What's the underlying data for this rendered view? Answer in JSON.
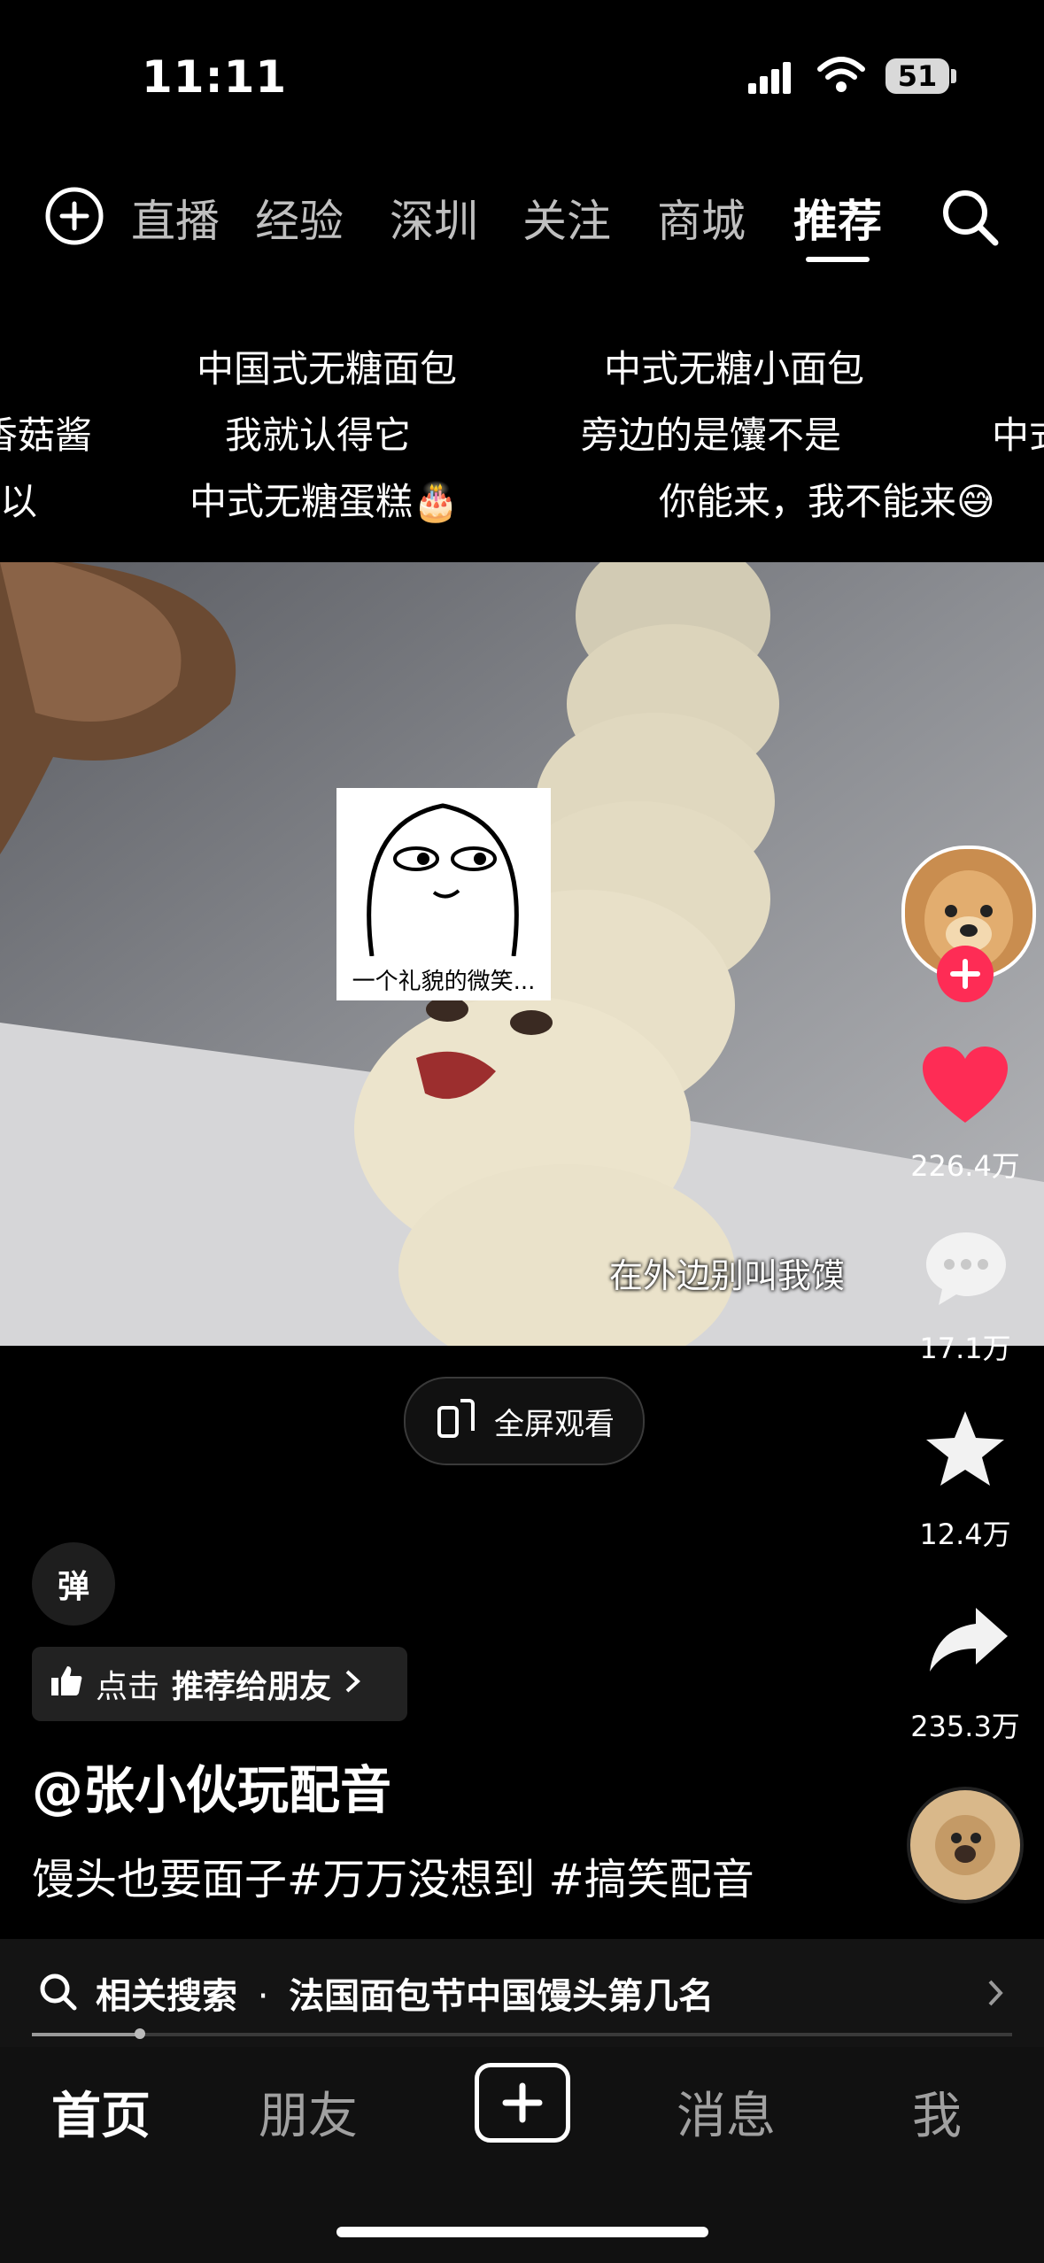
{
  "status": {
    "time": "11:11",
    "battery": "51"
  },
  "nav": {
    "tabs": [
      "直播",
      "经验",
      "深圳",
      "关注",
      "商城",
      "推荐"
    ],
    "active": "推荐"
  },
  "danmaku": {
    "row1": [
      "中国式无糖面包",
      "中式无糖小面包"
    ],
    "row2": [
      "香菇酱",
      "我就认得它",
      "旁边的是馕不是",
      "中式"
    ],
    "row3": [
      "以",
      "中式无糖蛋糕🎂",
      "你能来，我不能来😅"
    ]
  },
  "video": {
    "sticker_caption": "一个礼貌的微笑...",
    "subtitle": "在外边别叫我馍"
  },
  "fullscreen_label": "全屏观看",
  "rail": {
    "likes": "226.4万",
    "comments": "17.1万",
    "favorites": "12.4万",
    "shares": "235.3万"
  },
  "danmu_toggle": "弹",
  "recommend": {
    "prefix": "点击",
    "text": "推荐给朋友"
  },
  "author": "@张小伙玩配音",
  "caption": "馒头也要面子#万万没想到 #搞笑配音",
  "related": {
    "label": "相关搜索",
    "sep": "·",
    "query": "法国面包节中国馒头第几名"
  },
  "progress": 0.11,
  "bottom_nav": {
    "home": "首页",
    "friends": "朋友",
    "messages": "消息",
    "me": "我"
  },
  "colors": {
    "like": "#fe2c55",
    "follow": "#fe2c55"
  }
}
